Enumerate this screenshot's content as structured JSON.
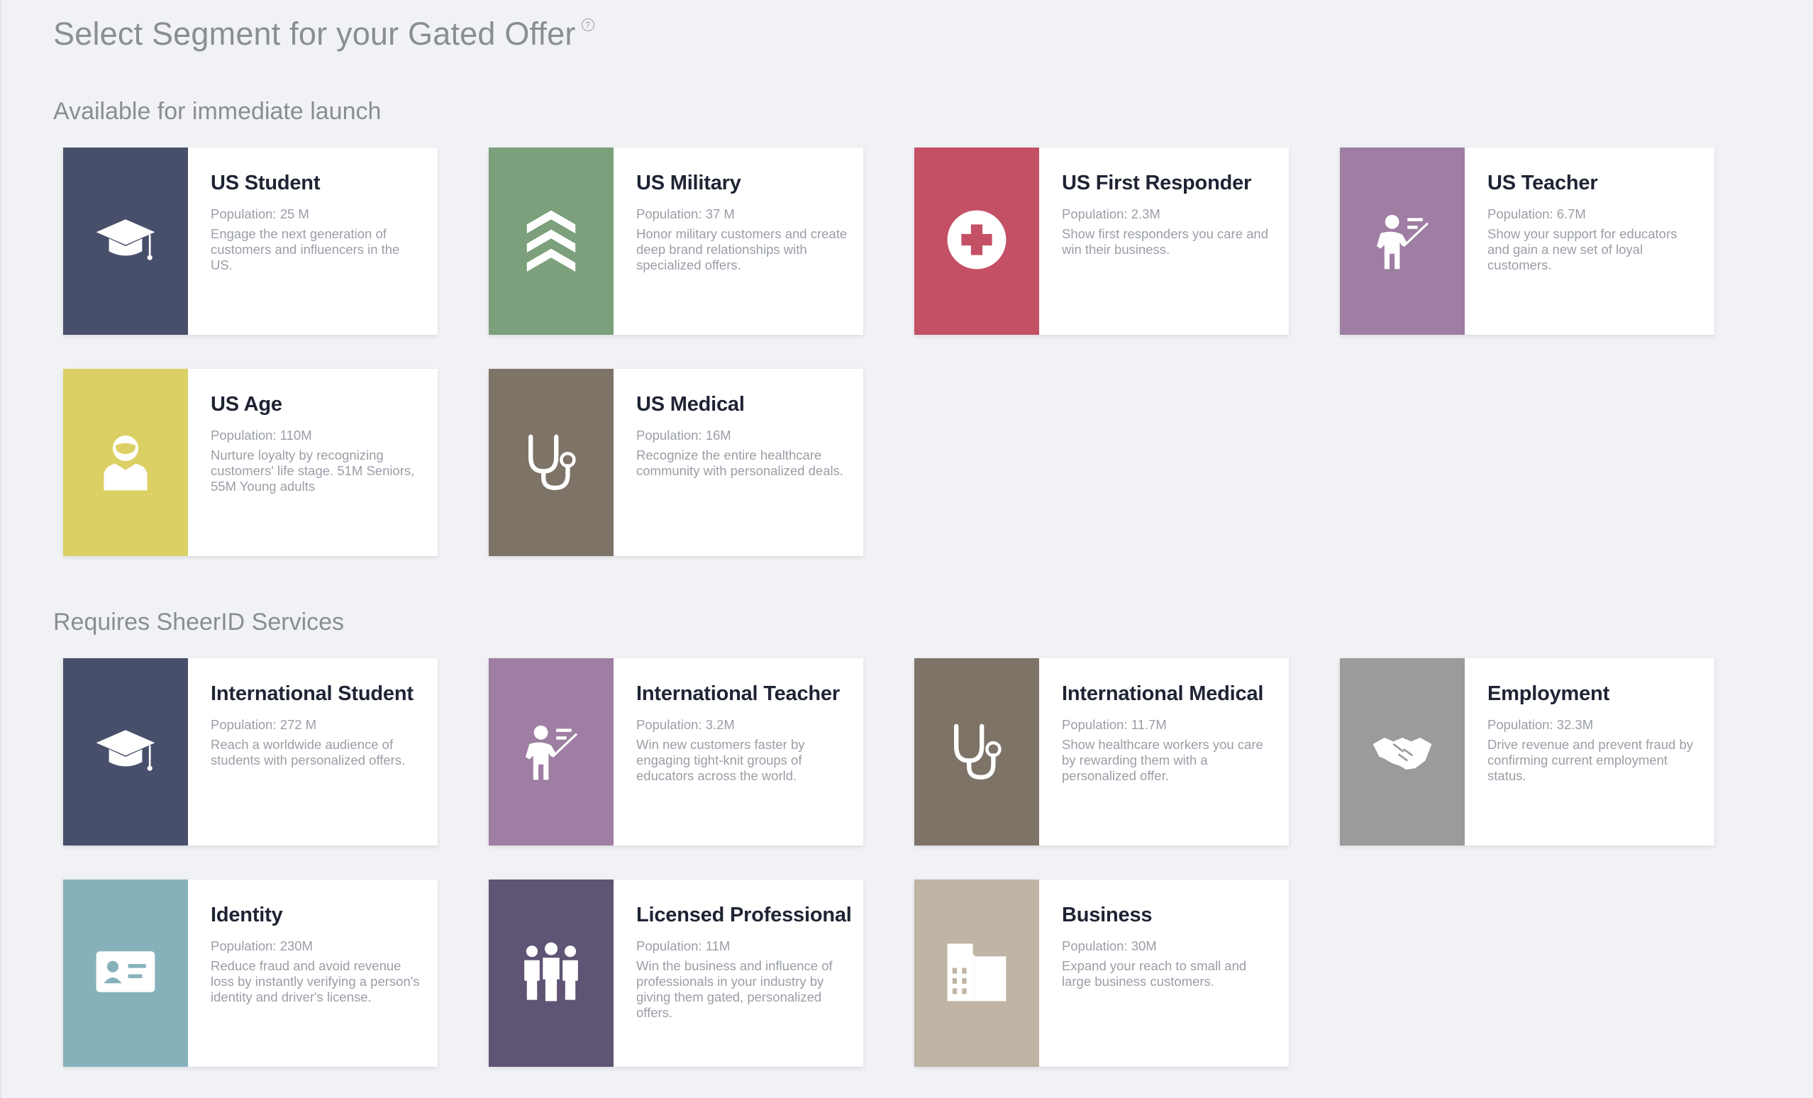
{
  "page": {
    "title": "Select Segment for your Gated Offer",
    "help_glyph": "?"
  },
  "sections": [
    {
      "title": "Available for immediate launch",
      "cards": [
        {
          "name": "US Student",
          "population": "Population: 25 M",
          "description": "Engage the next generation of customers and influencers in the US.",
          "color": "#474f6a",
          "icon": "graduation-cap-icon"
        },
        {
          "name": "US Military",
          "population": "Population: 37 M",
          "description": "Honor military customers and create deep brand relationships with specialized offers.",
          "color": "#7ba07b",
          "icon": "chevron-rank-icon"
        },
        {
          "name": "US First Responder",
          "population": "Population: 2.3M",
          "description": "Show first responders you care and win their business.",
          "color": "#c45065",
          "icon": "medical-cross-icon"
        },
        {
          "name": "US Teacher",
          "population": "Population: 6.7M",
          "description": "Show your support for educators and gain a new set of loyal customers.",
          "color": "#9e7ea2",
          "icon": "teacher-icon"
        },
        {
          "name": "US Age",
          "population": "Population: 110M",
          "description": "Nurture loyalty by recognizing customers' life stage. 51M Seniors, 55M Young adults",
          "color": "#dbd063",
          "icon": "person-icon"
        },
        {
          "name": "US Medical",
          "population": "Population: 16M",
          "description": "Recognize the entire healthcare community with personalized deals.",
          "color": "#7d7367",
          "icon": "stethoscope-icon"
        }
      ]
    },
    {
      "title": "Requires SheerID Services",
      "cards": [
        {
          "name": "International Student",
          "population": "Population: 272 M",
          "description": "Reach a worldwide audience of students with personalized offers.",
          "color": "#474f6a",
          "icon": "graduation-cap-icon"
        },
        {
          "name": "International Teacher",
          "population": "Population: 3.2M",
          "description": "Win new customers faster by engaging tight-knit groups of educators across the world.",
          "color": "#9e7ea2",
          "icon": "teacher-icon"
        },
        {
          "name": "International Medical",
          "population": "Population: 11.7M",
          "description": "Show healthcare workers you care by rewarding them with a personalized offer.",
          "color": "#7d7367",
          "icon": "stethoscope-icon"
        },
        {
          "name": "Employment",
          "population": "Population: 32.3M",
          "description": "Drive revenue and prevent fraud by confirming current employment status.",
          "color": "#9b9b9b",
          "icon": "handshake-icon"
        },
        {
          "name": "Identity",
          "population": "Population: 230M",
          "description": "Reduce fraud and avoid revenue loss by instantly verifying a person's identity and driver's license.",
          "color": "#86b1bb",
          "icon": "id-card-icon"
        },
        {
          "name": "Licensed Professional",
          "population": "Population: 11M",
          "description": "Win the business and influence of professionals in your industry by giving them gated, personalized offers.",
          "color": "#5f5474",
          "icon": "group-icon"
        },
        {
          "name": "Business",
          "population": "Population: 30M",
          "description": "Expand your reach to small and large business customers.",
          "color": "#bfb4a5",
          "icon": "building-icon"
        }
      ]
    }
  ]
}
